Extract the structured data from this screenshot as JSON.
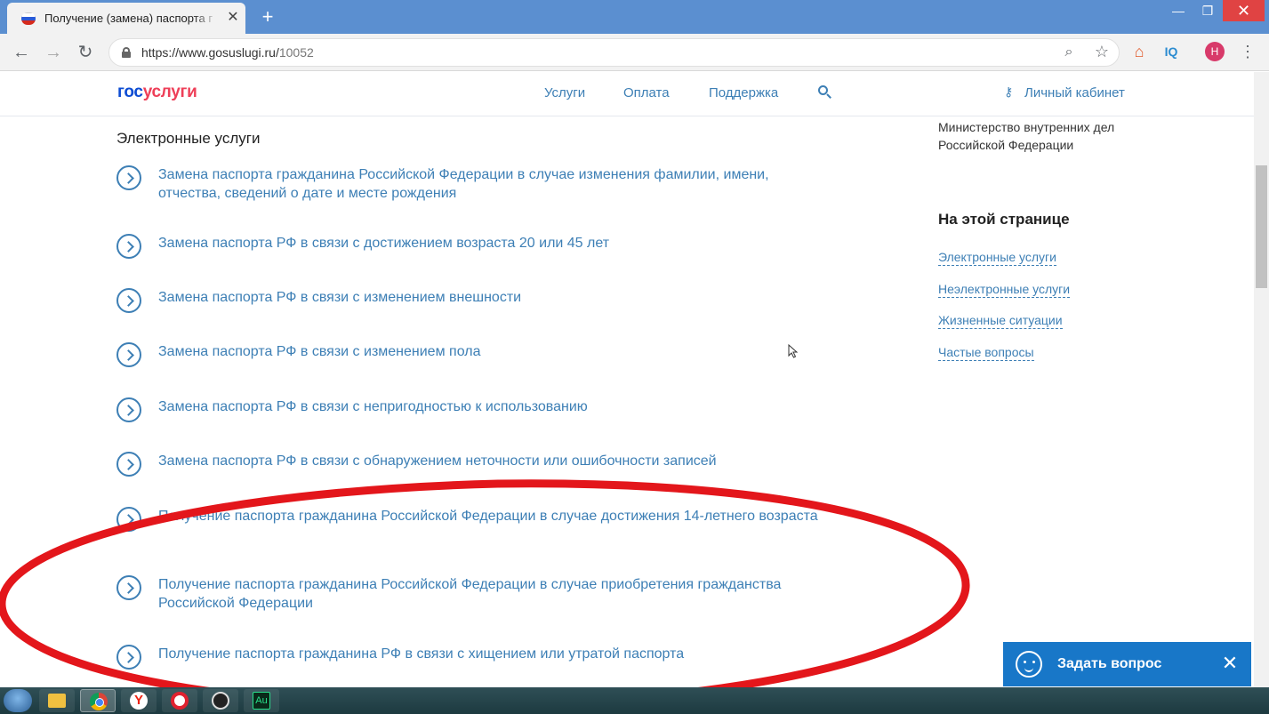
{
  "browser": {
    "tab_title": "Получение (замена) паспорта г",
    "url_host": "https://www.gosuslugi.ru/",
    "url_path": "10052",
    "profile_initial": "Н",
    "ext_iq_label": "IQ"
  },
  "header": {
    "logo_gos": "гос",
    "logo_uslugi": "услуги",
    "nav": {
      "services": "Услуги",
      "payment": "Оплата",
      "support": "Поддержка"
    },
    "cabinet": "Личный кабинет"
  },
  "main": {
    "section_title": "Электронные услуги",
    "services": [
      {
        "label": "Замена паспорта гражданина Российской Федерации в случае изменения фамилии, имени, отчества, сведений о дате и месте рождения"
      },
      {
        "label": "Замена паспорта РФ в связи с достижением возраста 20 или 45 лет"
      },
      {
        "label": "Замена паспорта РФ в связи с изменением внешности"
      },
      {
        "label": "Замена паспорта РФ в связи с изменением пола"
      },
      {
        "label": "Замена паспорта РФ в связи с непригодностью к использованию"
      },
      {
        "label": "Замена паспорта РФ в связи с обнаружением неточности или ошибочности записей"
      },
      {
        "label": "Получение паспорта гражданина Российской Федерации в случае достижения 14-летнего возраста"
      },
      {
        "label": "Получение паспорта гражданина Российской Федерации в случае приобретения гражданства Российской Федерации"
      },
      {
        "label": "Получение паспорта гражданина РФ в связи с хищением или утратой паспорта"
      }
    ]
  },
  "sidebar": {
    "ministry": "Министерство внутренних дел Российской Федерации",
    "on_page_title": "На этой странице",
    "links": [
      {
        "label": "Электронные услуги"
      },
      {
        "label": "Неэлектронные услуги"
      },
      {
        "label": "Жизненные ситуации"
      },
      {
        "label": "Частые вопросы"
      }
    ]
  },
  "ask_widget": {
    "label": "Задать вопрос"
  },
  "colors": {
    "link": "#3d7fb5",
    "logo_gos": "#0d4cd3",
    "logo_uslugi": "#ee3f58",
    "annotation": "#e3161b",
    "ask_widget_bg": "#1877c8",
    "browser_frame": "#5b8fd0"
  }
}
